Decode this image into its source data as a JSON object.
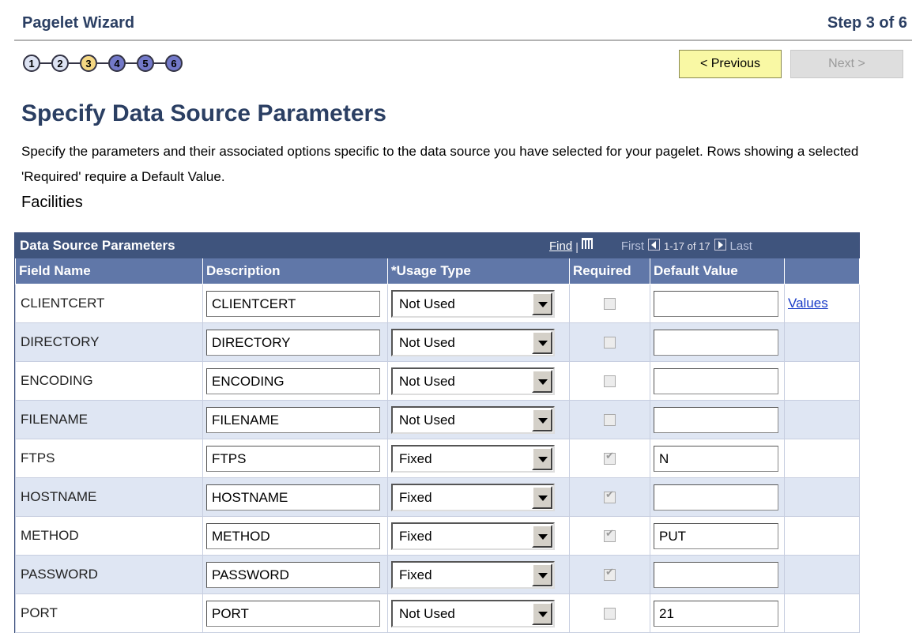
{
  "header": {
    "title": "Pagelet Wizard",
    "step_text": "Step 3 of 6"
  },
  "steps": [
    {
      "label": "1",
      "state": "done"
    },
    {
      "label": "2",
      "state": "done"
    },
    {
      "label": "3",
      "state": "current"
    },
    {
      "label": "4",
      "state": "future"
    },
    {
      "label": "5",
      "state": "future"
    },
    {
      "label": "6",
      "state": "future"
    }
  ],
  "buttons": {
    "previous": "< Previous",
    "next": "Next >"
  },
  "page": {
    "heading": "Specify Data Source Parameters",
    "description": "Specify the parameters and their associated options specific to the data source you have selected for your pagelet.  Rows showing a selected 'Required' require a Default Value.",
    "subtitle": "Facilities"
  },
  "grid": {
    "title": "Data Source Parameters",
    "find": "Find",
    "separator": "|",
    "first": "First",
    "range": "1-17 of 17",
    "last": "Last",
    "columns": {
      "field_name": "Field Name",
      "description": "Description",
      "usage_type": "*Usage Type",
      "required": "Required",
      "default_value": "Default Value"
    },
    "values_link": "Values",
    "rows": [
      {
        "field": "CLIENTCERT",
        "desc": "CLIENTCERT",
        "usage": "Not Used",
        "required": false,
        "default": ""
      },
      {
        "field": "DIRECTORY",
        "desc": "DIRECTORY",
        "usage": "Not Used",
        "required": false,
        "default": ""
      },
      {
        "field": "ENCODING",
        "desc": "ENCODING",
        "usage": "Not Used",
        "required": false,
        "default": ""
      },
      {
        "field": "FILENAME",
        "desc": "FILENAME",
        "usage": "Not Used",
        "required": false,
        "default": ""
      },
      {
        "field": "FTPS",
        "desc": "FTPS",
        "usage": "Fixed",
        "required": true,
        "default": "N"
      },
      {
        "field": "HOSTNAME",
        "desc": "HOSTNAME",
        "usage": "Fixed",
        "required": true,
        "default": ""
      },
      {
        "field": "METHOD",
        "desc": "METHOD",
        "usage": "Fixed",
        "required": true,
        "default": "PUT"
      },
      {
        "field": "PASSWORD",
        "desc": "PASSWORD",
        "usage": "Fixed",
        "required": true,
        "default": ""
      },
      {
        "field": "PORT",
        "desc": "PORT",
        "usage": "Not Used",
        "required": false,
        "default": "21"
      }
    ]
  },
  "colors": {
    "title_blue": "#2b3f63",
    "grid_header": "#3f547d",
    "column_header": "#6077a8",
    "row_alt": "#dfe6f3",
    "current_step": "#f5d883",
    "future_step": "#7379c9",
    "previous_button": "#f9f8a4"
  }
}
